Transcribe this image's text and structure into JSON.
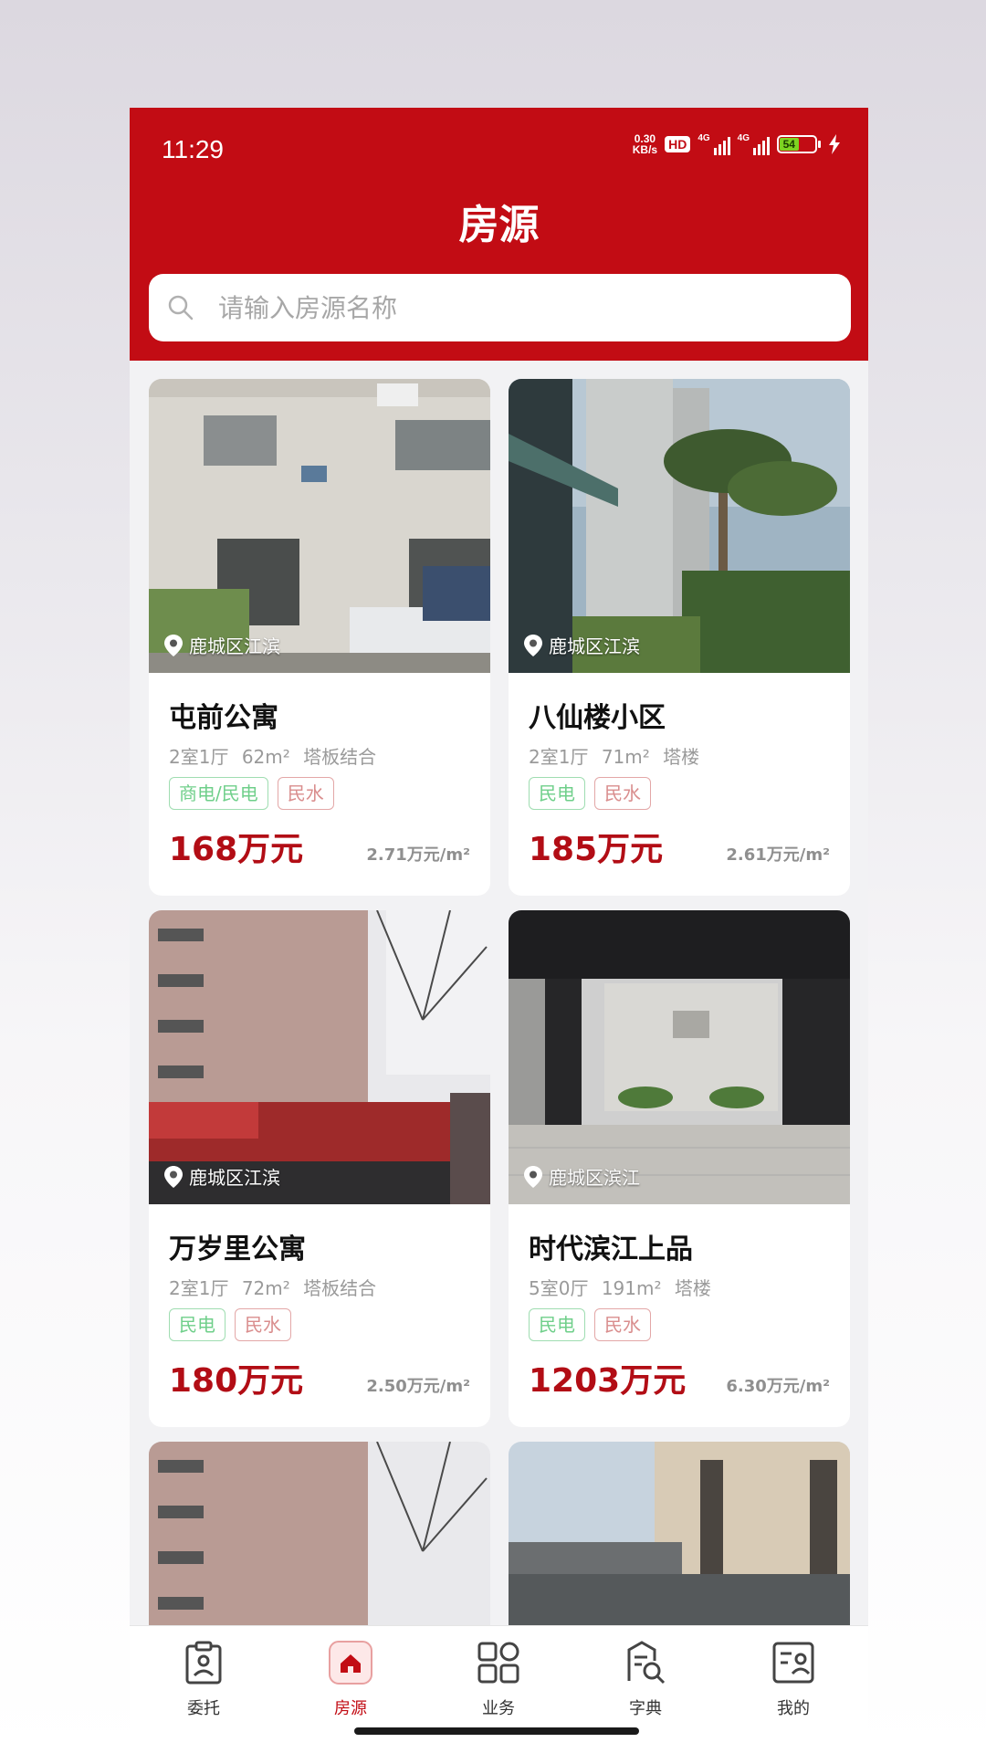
{
  "status_bar": {
    "time": "11:29",
    "net_speed_value": "0.30",
    "net_speed_unit": "KB/s",
    "hd_badge": "HD",
    "signal1_label": "4G",
    "signal2_label": "4G",
    "battery": "54"
  },
  "header": {
    "title": "房源"
  },
  "search": {
    "placeholder": "请输入房源名称",
    "value": ""
  },
  "listings": [
    {
      "name": "屯前公寓",
      "location": "鹿城区江滨",
      "layout": "2室1厅",
      "area": "62m²",
      "type": "塔板结合",
      "tags": [
        {
          "text": "商电/民电",
          "color": "green"
        },
        {
          "text": "民水",
          "color": "red"
        }
      ],
      "price": "168万元",
      "unit_price": "2.71万元/m²"
    },
    {
      "name": "八仙楼小区",
      "location": "鹿城区江滨",
      "layout": "2室1厅",
      "area": "71m²",
      "type": "塔楼",
      "tags": [
        {
          "text": "民电",
          "color": "green"
        },
        {
          "text": "民水",
          "color": "red"
        }
      ],
      "price": "185万元",
      "unit_price": "2.61万元/m²"
    },
    {
      "name": "万岁里公寓",
      "location": "鹿城区江滨",
      "layout": "2室1厅",
      "area": "72m²",
      "type": "塔板结合",
      "tags": [
        {
          "text": "民电",
          "color": "green"
        },
        {
          "text": "民水",
          "color": "red"
        }
      ],
      "price": "180万元",
      "unit_price": "2.50万元/m²"
    },
    {
      "name": "时代滨江上品",
      "location": "鹿城区滨江",
      "layout": "5室0厅",
      "area": "191m²",
      "type": "塔楼",
      "tags": [
        {
          "text": "民电",
          "color": "green"
        },
        {
          "text": "民水",
          "color": "red"
        }
      ],
      "price": "1203万元",
      "unit_price": "6.30万元/m²"
    }
  ],
  "tabbar": [
    {
      "label": "委托",
      "icon": "clipboard-icon",
      "active": false
    },
    {
      "label": "房源",
      "icon": "home-icon",
      "active": true
    },
    {
      "label": "业务",
      "icon": "grid-icon",
      "active": false
    },
    {
      "label": "字典",
      "icon": "book-search-icon",
      "active": false
    },
    {
      "label": "我的",
      "icon": "profile-card-icon",
      "active": false
    }
  ],
  "colors": {
    "brand": "#c20c14",
    "price": "#b20d15",
    "tag_green": "#6fcf8a",
    "tag_red": "#d98d8d"
  }
}
